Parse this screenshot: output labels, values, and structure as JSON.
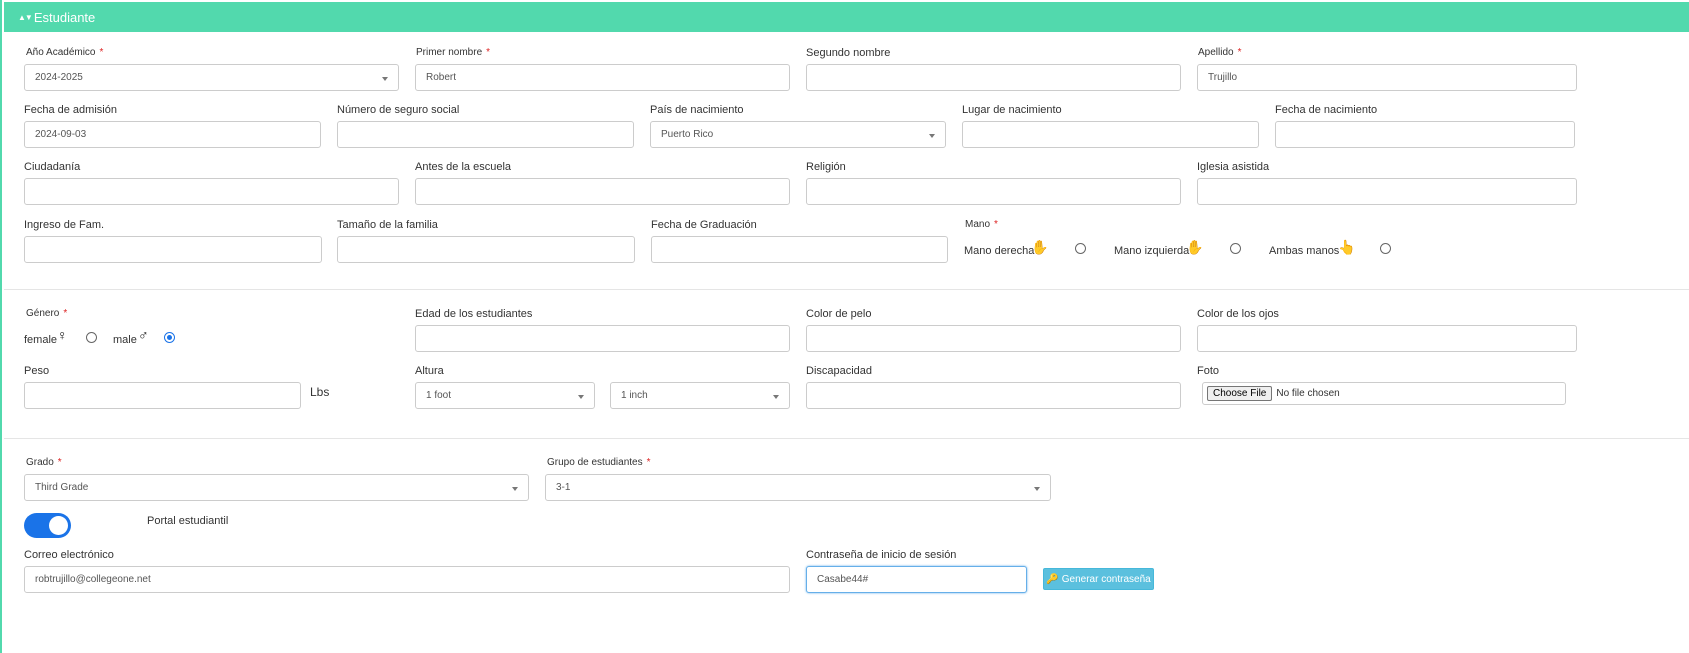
{
  "panel": {
    "title": "Estudiante"
  },
  "labels": {
    "academic_year": "Año Académico",
    "first_name": "Primer nombre",
    "middle_name": "Segundo nombre",
    "last_name": "Apellido",
    "admission_date": "Fecha de admisión",
    "ssn": "Número de seguro social",
    "birth_country": "País de nacimiento",
    "birth_place": "Lugar de nacimiento",
    "birth_date": "Fecha de nacimiento",
    "citizenship": "Ciudadanía",
    "previous_school": "Antes de la escuela",
    "religion": "Religión",
    "church": "Iglesia asistida",
    "family_income": "Ingreso de Fam.",
    "family_size": "Tamaño de la familia",
    "graduation_date": "Fecha de Graduación",
    "hand": "Mano",
    "gender": "Género",
    "student_age": "Edad de los estudiantes",
    "hair_color": "Color de pelo",
    "eye_color": "Color de los ojos",
    "weight": "Peso",
    "height": "Altura",
    "disability": "Discapacidad",
    "photo": "Foto",
    "grade": "Grado",
    "student_group": "Grupo de estudiantes",
    "student_portal": "Portal estudiantil",
    "email": "Correo electrónico",
    "login_password": "Contraseña de inicio de sesión"
  },
  "required_mark": "*",
  "values": {
    "academic_year": "2024-2025",
    "first_name": "Robert",
    "middle_name": "",
    "last_name": "Trujillo",
    "admission_date": "2024-09-03",
    "ssn": "",
    "birth_country": "Puerto Rico",
    "birth_place": "",
    "birth_date": "",
    "citizenship": "",
    "previous_school": "",
    "religion": "",
    "church": "",
    "family_income": "",
    "family_size": "",
    "graduation_date": "",
    "student_age": "",
    "hair_color": "",
    "eye_color": "",
    "weight": "",
    "height_feet": "1 foot",
    "height_inches": "1 inch",
    "disability": "",
    "grade": "Third Grade",
    "student_group": "3-1",
    "email": "robtrujillo@collegeone.net",
    "login_password": "Casabe44#"
  },
  "hand_options": [
    {
      "label": "Mano derecha",
      "selected": false,
      "icon": "right-hand-icon"
    },
    {
      "label": "Mano izquierda",
      "selected": false,
      "icon": "left-hand-icon"
    },
    {
      "label": "Ambas manos",
      "selected": false,
      "icon": "both-hands-icon"
    }
  ],
  "gender_options": [
    {
      "label": "female",
      "selected": false,
      "icon": "female-icon"
    },
    {
      "label": "male",
      "selected": true,
      "icon": "male-icon"
    }
  ],
  "weight_unit": "Lbs",
  "file_input": {
    "button": "Choose File",
    "status": "No file chosen"
  },
  "portal_enabled": true,
  "generate_password_button": "Generar contraseña",
  "colors": {
    "header": "#52d9ad",
    "accent": "#1a73e8",
    "button": "#5bc0de",
    "required": "#dd2222"
  }
}
